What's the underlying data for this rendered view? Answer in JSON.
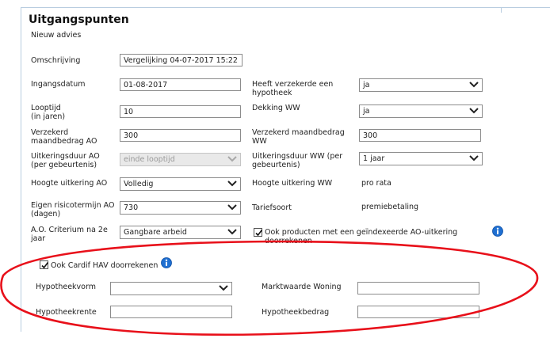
{
  "header": {
    "title": "Uitgangspunten",
    "subtitle": "Nieuw advies"
  },
  "form": {
    "omschrijving_label": "Omschrijving",
    "omschrijving_value": "Vergelijking 04-07-2017 15:22",
    "ingangsdatum_label": "Ingangsdatum",
    "ingangsdatum_value": "01-08-2017",
    "hypotheek_label": "Heeft verzekerde een\nhypotheek",
    "hypotheek_value": "ja",
    "looptijd_label": "Looptijd\n(in jaren)",
    "looptijd_value": "10",
    "dekking_ww_label": "Dekking WW",
    "dekking_ww_value": "ja",
    "maandbedrag_ao_label": "Verzekerd\nmaandbedrag AO",
    "maandbedrag_ao_value": "300",
    "maandbedrag_ww_label": "Verzekerd maandbedrag\nWW",
    "maandbedrag_ww_value": "300",
    "uitkeringsduur_ao_label": "Uitkeringsduur AO\n(per gebeurtenis)",
    "uitkeringsduur_ao_value": "einde looptijd",
    "uitkeringsduur_ww_label": "Uitkeringsduur WW (per\ngebeurtenis)",
    "uitkeringsduur_ww_value": "1 jaar",
    "hoogte_ao_label": "Hoogte uitkering AO",
    "hoogte_ao_value": "Volledig",
    "hoogte_ww_label": "Hoogte uitkering WW",
    "hoogte_ww_value": "pro rata",
    "risico_label": "Eigen risicotermijn AO\n(dagen)",
    "risico_value": "730",
    "tariefsoort_label": "Tariefsoort",
    "tariefsoort_value": "premiebetaling",
    "criterium_label": "A.O. Criterium na 2e\njaar",
    "criterium_value": "Gangbare arbeid",
    "geindexeerde_label": "Ook producten met een geïndexeerde AO-uitkering\ndoorrekenen",
    "geindexeerde_checked": true
  },
  "cardif": {
    "checkbox_label": "Ook Cardif HAV doorrekenen",
    "checked": true,
    "hypotheekvorm_label": "Hypotheekvorm",
    "hypotheekvorm_value": "",
    "marktwaarde_label": "Marktwaarde Woning",
    "marktwaarde_value": "",
    "hypotheekrente_label": "Hypotheekrente",
    "hypotheekrente_value": "",
    "hypotheekbedrag_label": "Hypotheekbedrag",
    "hypotheekbedrag_value": ""
  },
  "colors": {
    "annotation": "#e8101a",
    "info": "#1f6fd1",
    "border": "#8c8c8c"
  },
  "icons": {
    "info": "info-icon",
    "dropdown": "chevron-down-icon",
    "check": "checkmark-icon"
  }
}
